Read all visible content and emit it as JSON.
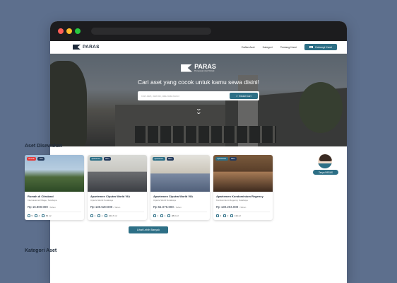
{
  "brand": {
    "name": "PARAS",
    "tagline": "Penyewaan Aset Terbaik"
  },
  "nav": {
    "links": [
      "Daftar Aset",
      "Kategori",
      "Tentang Kami"
    ],
    "contact_label": "Hubungi Kami"
  },
  "hero": {
    "title": "Cari aset yang cocok untuk kamu sewa disini!",
    "search_placeholder": "Cari aset, daerah, atau kata kunci",
    "search_button": "Mulai Cari"
  },
  "section_title": "Aset Disewakan",
  "section2_title": "Kategori Aset",
  "assistant_label": "Tanya PARAS",
  "more_button": "Lihat Lebih Banyak",
  "listings": [
    {
      "badges": [
        "Rumah",
        "Disc"
      ],
      "title": "Rumah di Citraland",
      "location": "Internasional Village, Surabaya",
      "price": "Rp 16.800.000",
      "period": "/ Tahun",
      "beds": "5",
      "baths": "4",
      "area": "84 m²"
    },
    {
      "badges": [
        "Apartemen",
        "Baru"
      ],
      "title": "Apartemen Ciputra World VIA",
      "location": "Ciputra World Surabaya",
      "price": "Rp 130.520.000",
      "period": "/ Tahun",
      "beds": "1",
      "baths": "1",
      "area": "104,7 m²"
    },
    {
      "badges": [
        "Apartemen",
        "Baru"
      ],
      "title": "Apartemen Ciputra World VIA",
      "location": "Ciputra World Surabaya",
      "price": "Rp 51.075.000",
      "period": "/ Tahun",
      "beds": "1",
      "baths": "1",
      "area": "38,0 m²"
    },
    {
      "badges": [
        "Apartemen",
        "Baru"
      ],
      "title": "Apartemen Kondominium Regency",
      "location": "Kondominium Regency Surabaya",
      "price": "Rp 130.204.000",
      "period": "/ Tahun",
      "beds": "3",
      "baths": "2",
      "area": "134 m²"
    }
  ],
  "colors": {
    "accent": "#2d6f86",
    "background": "#5d6f8d",
    "heading": "#1e2a3a",
    "badge_red": "#e23a3a"
  }
}
